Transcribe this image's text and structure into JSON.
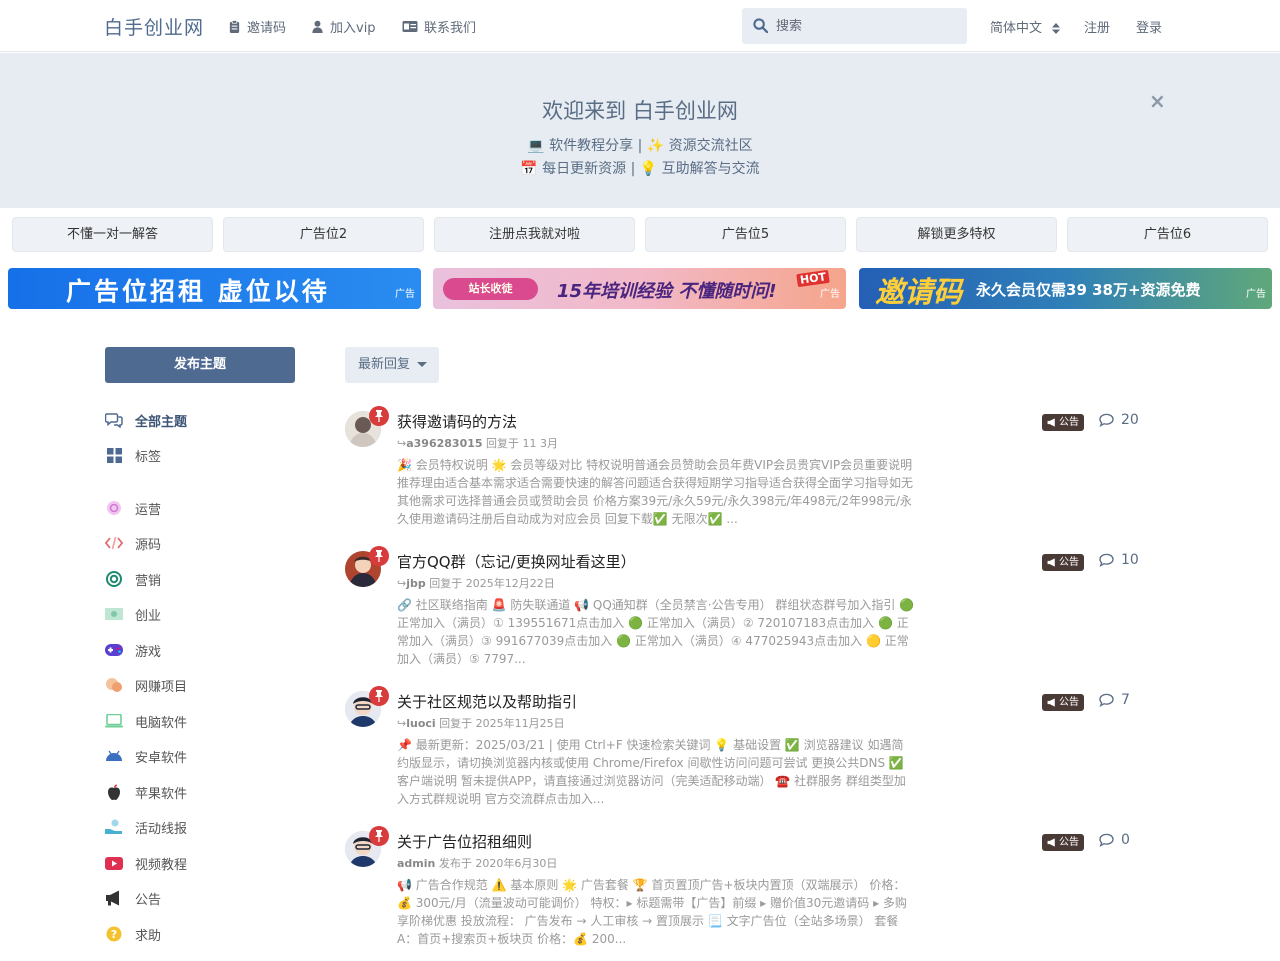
{
  "header": {
    "brand": "白手创业网",
    "nav": [
      {
        "label": "邀请码",
        "icon": "clipboard-icon"
      },
      {
        "label": "加入vip",
        "icon": "user-icon"
      },
      {
        "label": "联系我们",
        "icon": "id-card-icon"
      }
    ],
    "search_placeholder": "搜索",
    "language": "简体中文",
    "register": "注册",
    "login": "登录"
  },
  "hero": {
    "title": "欢迎来到 白手创业网",
    "line1": "💻 软件教程分享 | ✨ 资源交流社区",
    "line2": "📅 每日更新资源 | 💡 互助解答与交流",
    "close": "×"
  },
  "ad_row": [
    "不懂一对一解答",
    "广告位2",
    "注册点我就对啦",
    "广告位5",
    "解锁更多特权",
    "广告位6"
  ],
  "banners": [
    {
      "text": "广告位招租  虚位以待",
      "tag": "广告",
      "bg": "#1677e0"
    },
    {
      "label": "站长收徒",
      "text": "15年培训经验 不懂随时问!",
      "hot": "HOT",
      "tag": "广告",
      "bg": "#efb8d8"
    },
    {
      "text": "邀请码",
      "sub": "永久会员仅需39  38万+资源免费",
      "tag": "广告",
      "bg": "#2a6fb0"
    }
  ],
  "sidebar": {
    "post_button": "发布主题",
    "items": [
      {
        "label": "全部主题",
        "icon": "comments-icon",
        "color": "#4e6a91",
        "active": true
      },
      {
        "label": "标签",
        "icon": "grid-icon",
        "color": "#4e6a91"
      },
      {
        "label": "运营",
        "icon": "cog-icon",
        "color": "#e08be0"
      },
      {
        "label": "源码",
        "icon": "code-icon",
        "color": "#e06c6c"
      },
      {
        "label": "营销",
        "icon": "target-icon",
        "color": "#1f8a70"
      },
      {
        "label": "创业",
        "icon": "money-icon",
        "color": "#7fc7a8"
      },
      {
        "label": "游戏",
        "icon": "gamepad-icon",
        "color": "#5a3fd0"
      },
      {
        "label": "网赚项目",
        "icon": "coins-icon",
        "color": "#f0a070"
      },
      {
        "label": "电脑软件",
        "icon": "laptop-icon",
        "color": "#6fcf97"
      },
      {
        "label": "安卓软件",
        "icon": "android-icon",
        "color": "#3c6fbf"
      },
      {
        "label": "苹果软件",
        "icon": "apple-icon",
        "color": "#333333"
      },
      {
        "label": "活动线报",
        "icon": "hand-icon",
        "color": "#4ab0d0"
      },
      {
        "label": "视频教程",
        "icon": "youtube-icon",
        "color": "#e03050"
      },
      {
        "label": "公告",
        "icon": "megaphone-icon",
        "color": "#333333"
      },
      {
        "label": "求助",
        "icon": "question-icon",
        "color": "#f2c230"
      }
    ]
  },
  "sort": {
    "label": "最新回复"
  },
  "topics": [
    {
      "title": "获得邀请码的方法",
      "user": "a396283015",
      "action": "回复于 11 3月",
      "excerpt": "🎉 会员特权说明 🌟 会员等级对比 特权说明普通会员赞助会员年费VIP会员贵宾VIP会员重要说明推荐理由适合基本需求适合需要快速的解答问题适合获得短期学习指导适合获得全面学习指导如无其他需求可选择普通会员或赞助会员 价格方案39元/永久59元/永久398元/年498元/2年998元/永久使用邀请码注册后自动成为对应会员 回复下载✅ 无限次✅ ...",
      "tag": "公告",
      "replies": "20",
      "avatar_color": "#d8d2cc"
    },
    {
      "title": "官方QQ群（忘记/更换网址看这里）",
      "user": "jbp",
      "action": "回复于 2025年12月22日",
      "excerpt": "🔗 社区联络指南 🚨 防失联通道 📢 QQ通知群（全员禁言·公告专用） 群组状态群号加入指引 🟢 正常加入（满员）① 139551671点击加入 🟢 正常加入（满员）② 720107183点击加入 🟢 正常加入（满员）③ 991677039点击加入 🟢 正常加入（满员）④ 477025943点击加入 🟡 正常加入（满员）⑤ 7797...",
      "tag": "公告",
      "replies": "10",
      "avatar_color": "#c8543a"
    },
    {
      "title": "关于社区规范以及帮助指引",
      "user": "luoci",
      "action": "回复于 2025年11月25日",
      "excerpt": "📌 最新更新：2025/03/21 | 使用 Ctrl+F 快速检索关键词 💡 基础设置 ✅ 浏览器建议 如遇简约版显示，请切换浏览器内核或使用 Chrome/Firefox 间歇性访问问题可尝试 更换公共DNS ✅ 客户端说明 暂未提供APP，请直接通过浏览器访问（完美适配移动端） ☎️ 社群服务 群组类型加入方式群规说明 官方交流群点击加入...",
      "tag": "公告",
      "replies": "7",
      "avatar_color": "#2b3140"
    },
    {
      "title": "关于广告位招租细则",
      "user": "admin",
      "action": "发布于 2020年6月30日",
      "excerpt": "📢 广告合作规范 ⚠️ 基本原则 🌟 广告套餐 🏆 首页置顶广告+板块内置顶（双端展示） 价格：💰 300元/月（流量波动可能调价） 特权：▸ 标题需带【广告】前缀 ▸ 赠价值30元邀请码 ▸ 多购享阶梯优惠 投放流程： 广告发布 → 人工审核 → 置顶展示 📃 文字广告位（全站多场景） 套餐A：首页+搜索页+板块页 价格：💰 200...",
      "tag": "公告",
      "replies": "0",
      "avatar_color": "#2b3140"
    }
  ]
}
